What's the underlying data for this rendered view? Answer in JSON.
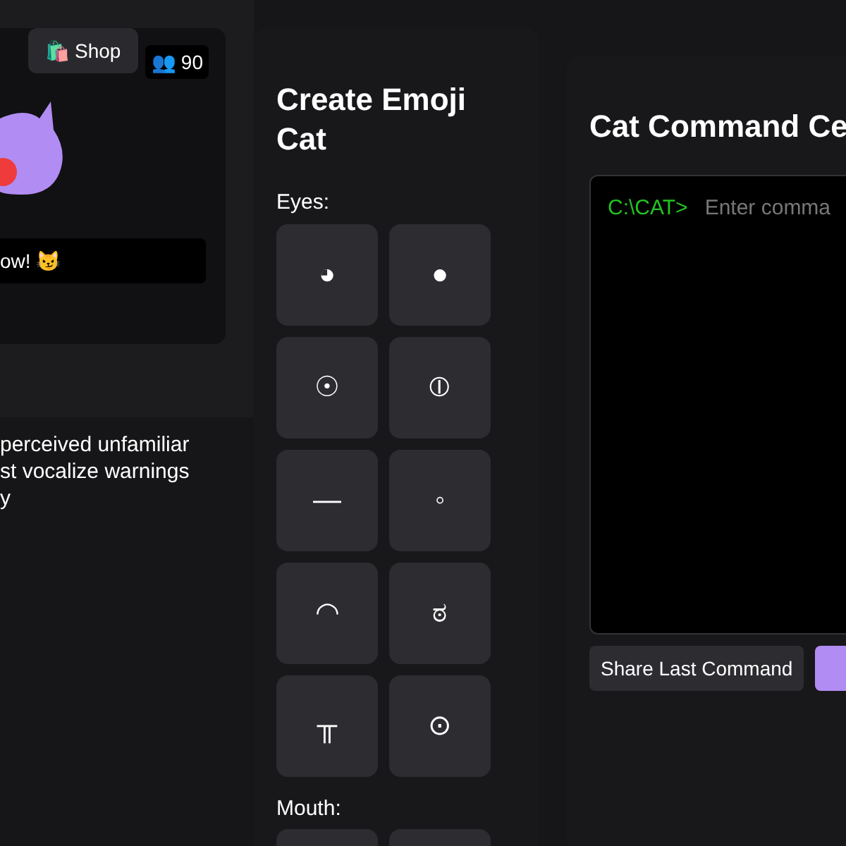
{
  "shop_button": {
    "icon": "🛍️",
    "label": "Shop"
  },
  "viewer_badge": {
    "icon": "👥",
    "count": "90"
  },
  "cat_message": {
    "text": "ow! 😼"
  },
  "description_lines": [
    "perceived unfamiliar",
    "st vocalize warnings",
    "y"
  ],
  "emoji_builder": {
    "title": "Create Emoji Cat",
    "eyes_label": "Eyes:",
    "eye_options": [
      "◕",
      "●",
      "☉",
      "⦶",
      "—",
      "◦",
      "◠",
      "ಠ",
      "╥",
      "⊙"
    ],
    "mouth_label": "Mouth:"
  },
  "command_center": {
    "title": "Cat Command Ce",
    "prompt": "C:\\CAT>",
    "placeholder": "Enter comma",
    "share_button": "Share Last Command"
  }
}
